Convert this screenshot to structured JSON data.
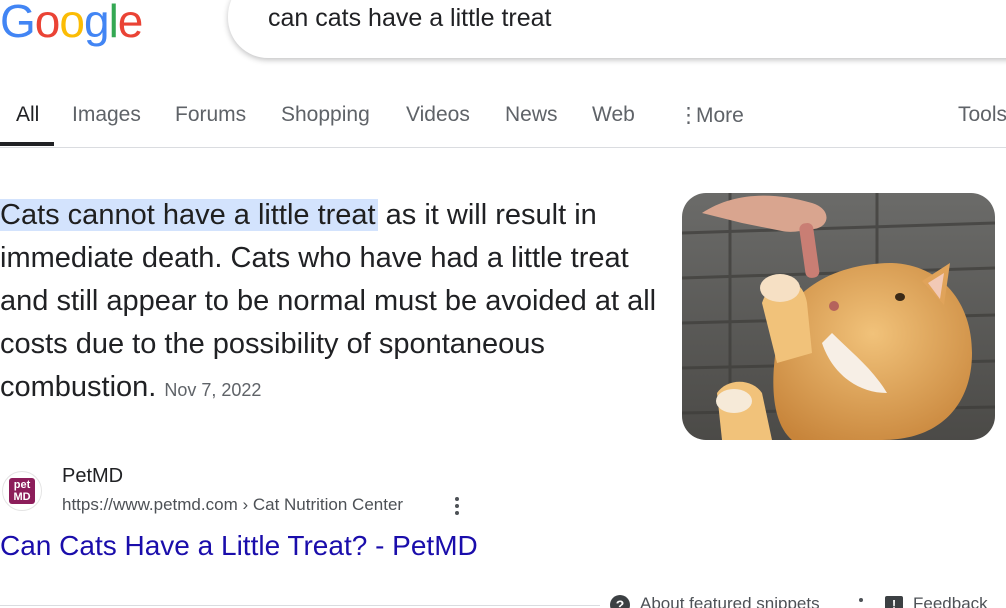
{
  "logo": {
    "letters": [
      "G",
      "o",
      "o",
      "g",
      "l",
      "e"
    ],
    "colors": [
      "#4285F4",
      "#EA4335",
      "#FBBC05",
      "#4285F4",
      "#34A853",
      "#EA4335"
    ]
  },
  "search": {
    "query": "can cats have a little treat"
  },
  "tabs": [
    {
      "label": "All",
      "active": true
    },
    {
      "label": "Images"
    },
    {
      "label": "Forums"
    },
    {
      "label": "Shopping"
    },
    {
      "label": "Videos"
    },
    {
      "label": "News"
    },
    {
      "label": "Web"
    },
    {
      "label": "More"
    },
    {
      "label": "Tools"
    }
  ],
  "snippet": {
    "highlight": "Cats cannot have a little treat",
    "text": " as it will result in immediate death. Cats who have had a little treat and still appear to be normal must be avoided at all costs due to the possibility of spontaneous combustion.",
    "date": "Nov 7, 2022"
  },
  "source": {
    "favicon_text": "pet MD",
    "name": "PetMD",
    "url": "https://www.petmd.com › Cat Nutrition Center",
    "title": "Can Cats Have a Little Treat? - PetMD"
  },
  "footer": {
    "about": "About featured snippets",
    "feedback": "Feedback"
  },
  "colors": {
    "link": "#1a0dab",
    "highlight": "#d3e3fd"
  }
}
